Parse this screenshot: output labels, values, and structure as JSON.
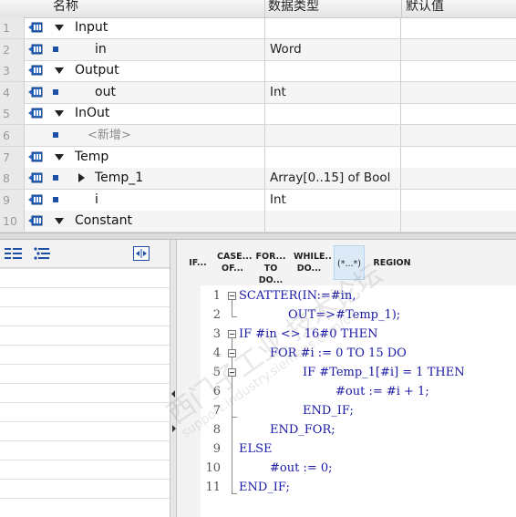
{
  "table": {
    "headers": {
      "name": "名称",
      "type": "数据类型",
      "default": "默认值"
    },
    "rows": [
      {
        "num": "1",
        "name": "Input",
        "type": ""
      },
      {
        "num": "2",
        "name": "in",
        "type": "Word"
      },
      {
        "num": "3",
        "name": "Output",
        "type": ""
      },
      {
        "num": "4",
        "name": "out",
        "type": "Int"
      },
      {
        "num": "5",
        "name": "InOut",
        "type": ""
      },
      {
        "num": "6",
        "name": "<新增>",
        "type": ""
      },
      {
        "num": "7",
        "name": "Temp",
        "type": ""
      },
      {
        "num": "8",
        "name": "Temp_1",
        "type": "Array[0..15] of Bool"
      },
      {
        "num": "9",
        "name": "i",
        "type": "Int"
      },
      {
        "num": "10",
        "name": "Constant",
        "type": ""
      }
    ]
  },
  "keywords": [
    {
      "l1": "IF...",
      "l2": ""
    },
    {
      "l1": "CASE...",
      "l2": "OF..."
    },
    {
      "l1": "FOR...",
      "l2": "TO DO..."
    },
    {
      "l1": "WHILE..",
      "l2": "DO..."
    },
    {
      "l1": "(*...*)",
      "l2": ""
    },
    {
      "l1": "REGION",
      "l2": ""
    }
  ],
  "code": {
    "lines": [
      {
        "n": "1",
        "text": "SCATTER(IN:=#in,"
      },
      {
        "n": "2",
        "text": "OUT=>#Temp_1);"
      },
      {
        "n": "3",
        "text": "IF #in <> 16#0 THEN"
      },
      {
        "n": "4",
        "text": "FOR #i := 0 TO 15 DO"
      },
      {
        "n": "5",
        "text": "IF #Temp_1[#i] = 1 THEN"
      },
      {
        "n": "6",
        "text": "#out := #i + 1;"
      },
      {
        "n": "7",
        "text": "END_IF;"
      },
      {
        "n": "8",
        "text": "END_FOR;"
      },
      {
        "n": "9",
        "text": "ELSE"
      },
      {
        "n": "10",
        "text": "#out := 0;"
      },
      {
        "n": "11",
        "text": "END_IF;"
      }
    ]
  },
  "colors": {
    "keyword_blue": "#1a1aa6",
    "param_blue": "#1c4fa8",
    "selected_kw": "#dbeaf6"
  },
  "icons": [
    "interface-section-icon",
    "indent-icon",
    "outdent-icon",
    "expand-icon"
  ]
}
